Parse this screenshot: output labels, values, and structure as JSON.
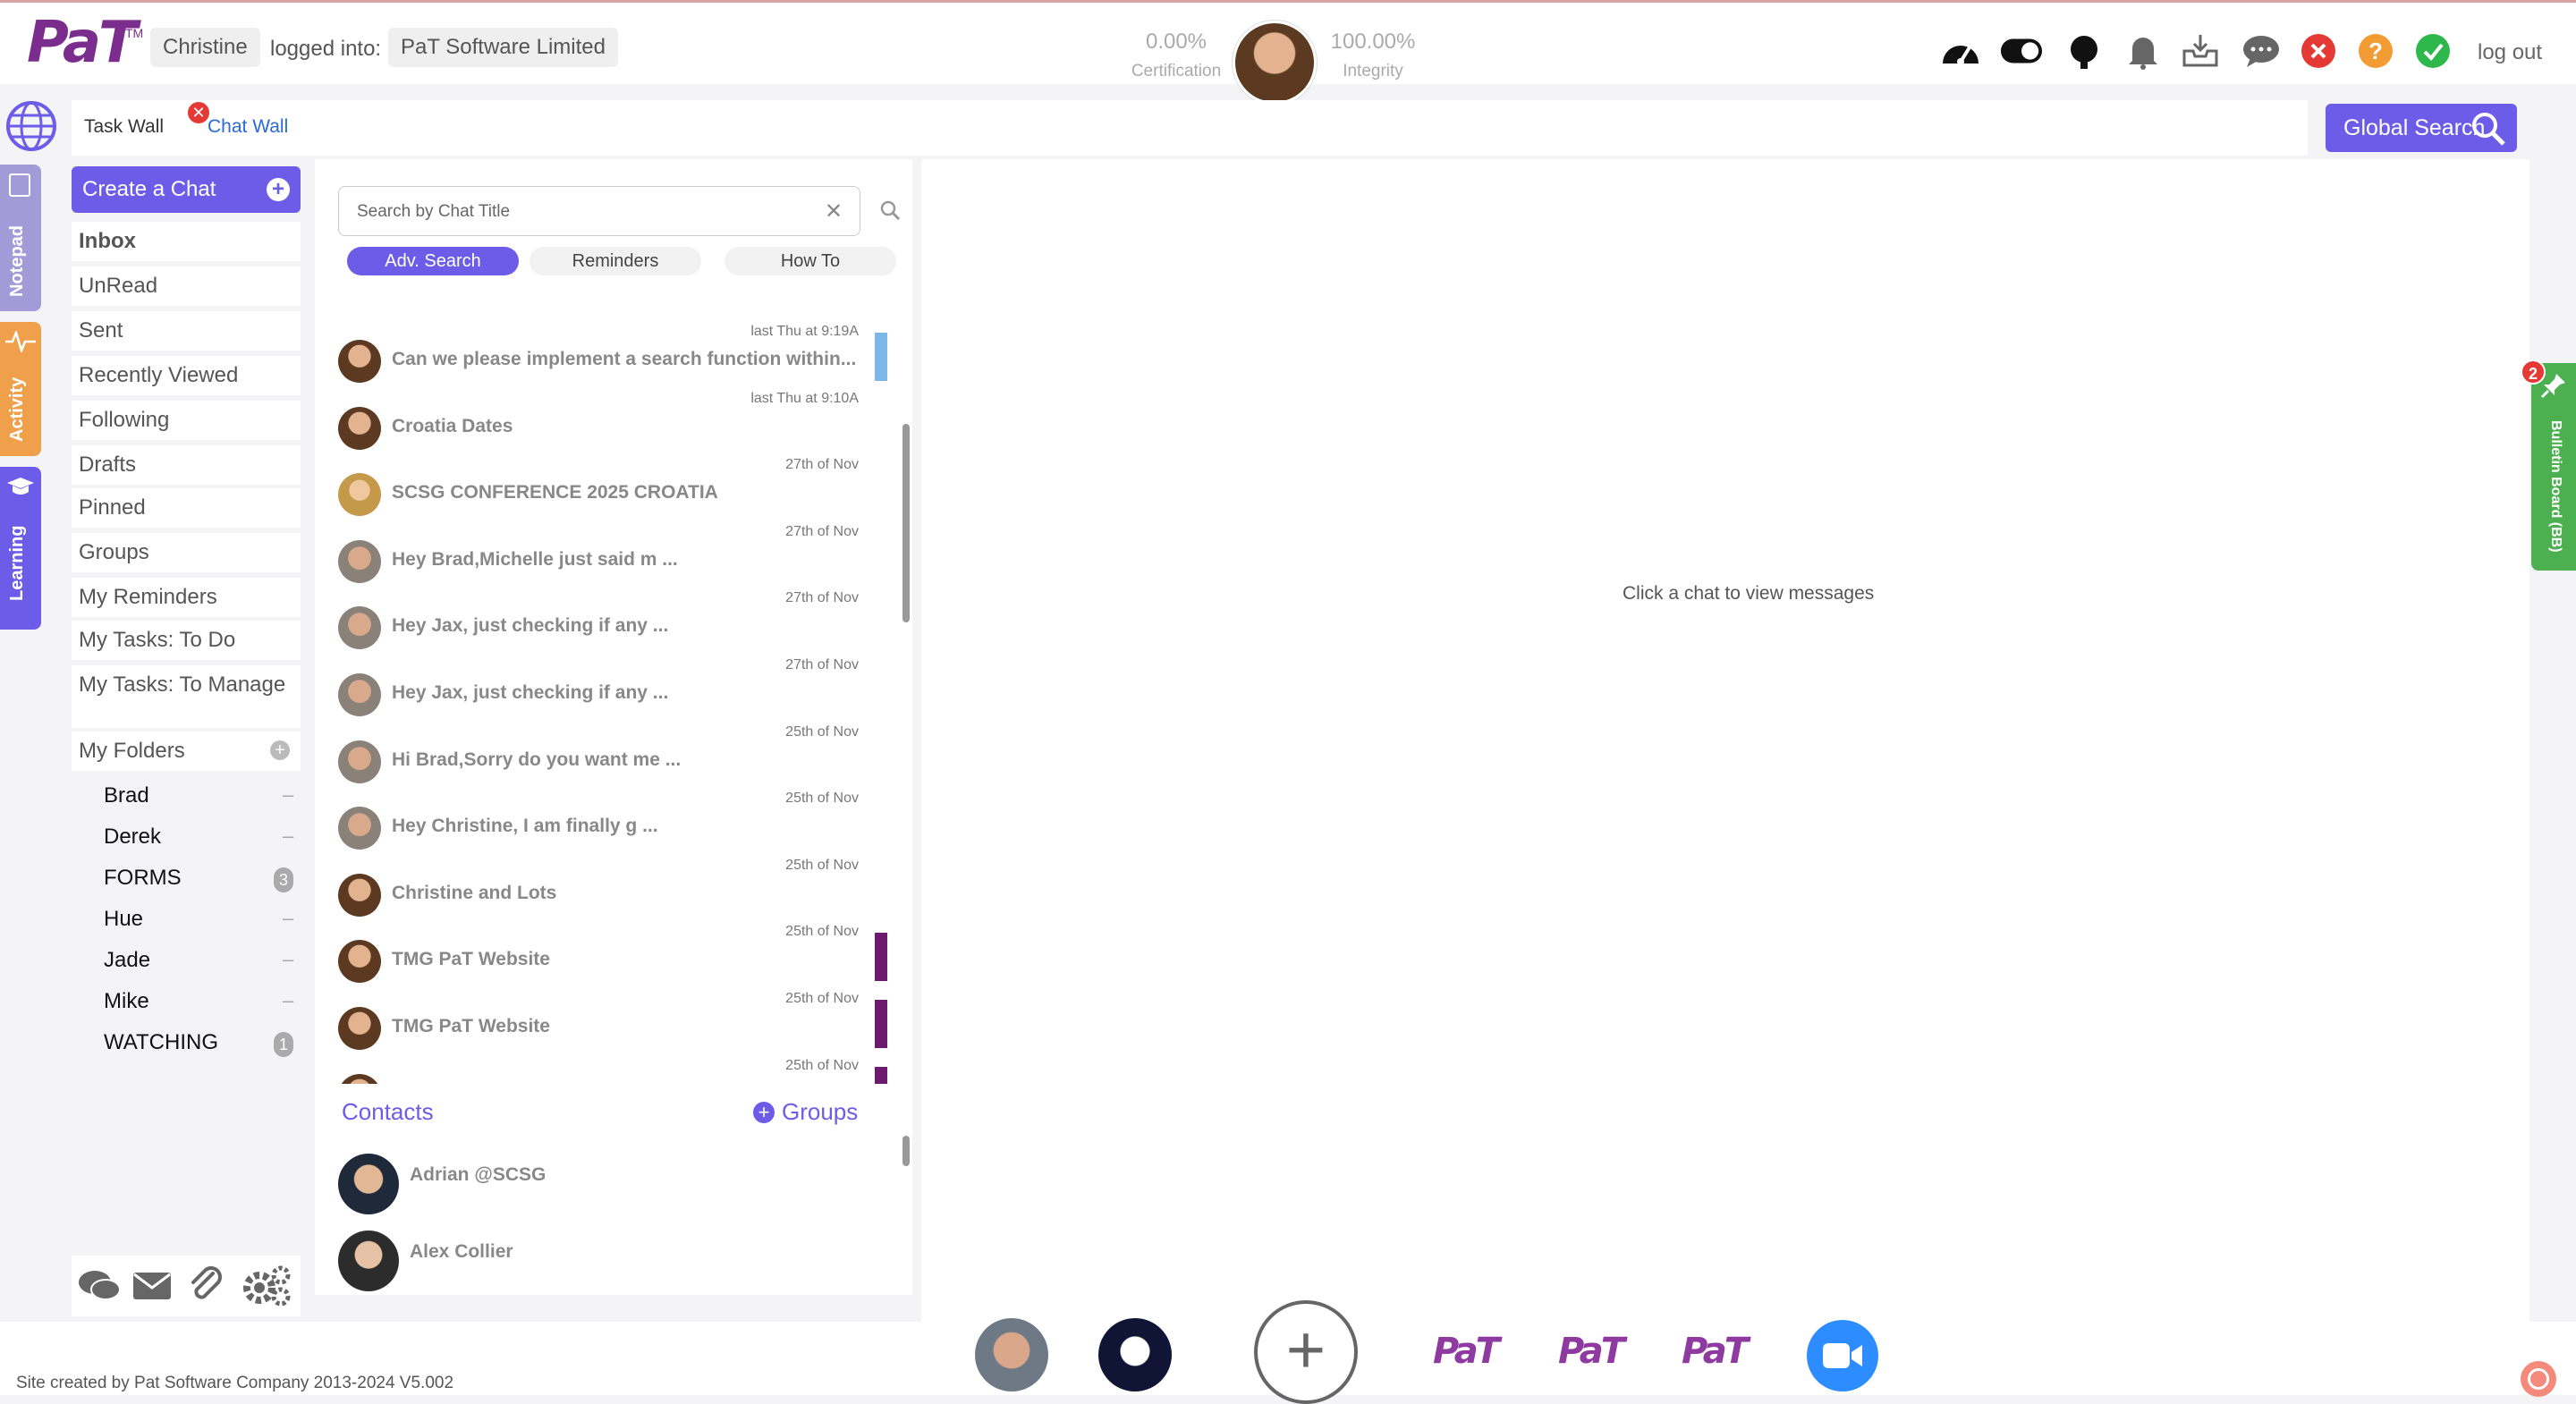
{
  "header": {
    "user_name": "Christine",
    "logged_into_label": "logged into:",
    "company": "PaT Software Limited",
    "certification_value": "0.00%",
    "certification_label": "Certification",
    "integrity_value": "100.00%",
    "integrity_label": "Integrity",
    "logout": "log out",
    "icons": [
      "dashboard-icon",
      "toggle-icon",
      "headset-icon",
      "bell-icon",
      "inbox-icon",
      "chat-bubble-icon",
      "close-circle-icon",
      "help-icon",
      "check-circle-icon"
    ]
  },
  "logo": {
    "text": "PaT",
    "tm": "TM"
  },
  "nav": {
    "task_wall": "Task Wall",
    "chat_wall": "Chat Wall",
    "global_search": "Global Search"
  },
  "side_tabs": {
    "notepad": "Notepad",
    "activity": "Activity",
    "learning": "Learning"
  },
  "sidebar": {
    "create_chat": "Create a Chat",
    "items": [
      "Inbox",
      "UnRead",
      "Sent",
      "Recently Viewed",
      "Following",
      "Drafts",
      "Pinned",
      "Groups",
      "My Reminders",
      "My Tasks: To Do",
      "My Tasks: To Manage",
      "My Folders"
    ],
    "folders": [
      {
        "name": "Brad",
        "badge": ""
      },
      {
        "name": "Derek",
        "badge": ""
      },
      {
        "name": "FORMS",
        "badge": "3"
      },
      {
        "name": "Hue",
        "badge": ""
      },
      {
        "name": "Jade",
        "badge": ""
      },
      {
        "name": "Mike",
        "badge": ""
      },
      {
        "name": "WATCHING",
        "badge": "1"
      }
    ],
    "footer_icons": [
      "chats-icon",
      "mail-icon",
      "paperclip-icon",
      "settings-icon"
    ]
  },
  "chat_list": {
    "search_placeholder": "Search by Chat Title",
    "filters": [
      "Adv. Search",
      "Reminders",
      "How To"
    ],
    "chats": [
      {
        "time": "last Thu at 9:19A",
        "title": "Can we please implement a search function within...",
        "avatar": "f",
        "marker": "#7fb6e8"
      },
      {
        "time": "last Thu at 9:10A",
        "title": "Croatia Dates",
        "avatar": "f",
        "marker": ""
      },
      {
        "time": "27th of Nov",
        "title": "SCSG CONFERENCE 2025 CROATIA",
        "avatar": "b",
        "marker": ""
      },
      {
        "time": "27th of Nov",
        "title": "Hey Brad,Michelle just said m ...",
        "avatar": "m",
        "marker": ""
      },
      {
        "time": "27th of Nov",
        "title": "Hey Jax, just checking if any ...",
        "avatar": "m",
        "marker": ""
      },
      {
        "time": "27th of Nov",
        "title": "Hey Jax, just checking if any ...",
        "avatar": "m",
        "marker": ""
      },
      {
        "time": "25th of Nov",
        "title": "Hi Brad,Sorry do you want me ...",
        "avatar": "m",
        "marker": ""
      },
      {
        "time": "25th of Nov",
        "title": "Hey Christine, I am finally g ...",
        "avatar": "m",
        "marker": ""
      },
      {
        "time": "25th of Nov",
        "title": "Christine and Lots",
        "avatar": "f",
        "marker": ""
      },
      {
        "time": "25th of Nov",
        "title": "TMG PaT Website",
        "avatar": "f",
        "marker": "#6b1a6e"
      },
      {
        "time": "25th of Nov",
        "title": "TMG PaT Website",
        "avatar": "f",
        "marker": "#6b1a6e"
      },
      {
        "time": "25th of Nov",
        "title": "",
        "avatar": "f",
        "marker": "#6b1a6e"
      }
    ]
  },
  "contacts": {
    "label": "Contacts",
    "groups_label": "Groups",
    "list": [
      {
        "name": "Adrian @SCSG"
      },
      {
        "name": "Alex Collier"
      }
    ]
  },
  "main": {
    "empty_message": "Click a chat to view messages"
  },
  "bulletin": {
    "label": "Bulletin Board (BB)",
    "badge": "2"
  },
  "footer": {
    "credit": "Site created by Pat Software Company 2013-2024 V5.002"
  },
  "colors": {
    "accent": "#6c5ce7",
    "brand": "#7b2d8e",
    "notepad_tab": "#a29bd8",
    "activity_tab": "#f0a04b",
    "learning_tab": "#6c5ce7",
    "bulletin": "#4caf50"
  }
}
